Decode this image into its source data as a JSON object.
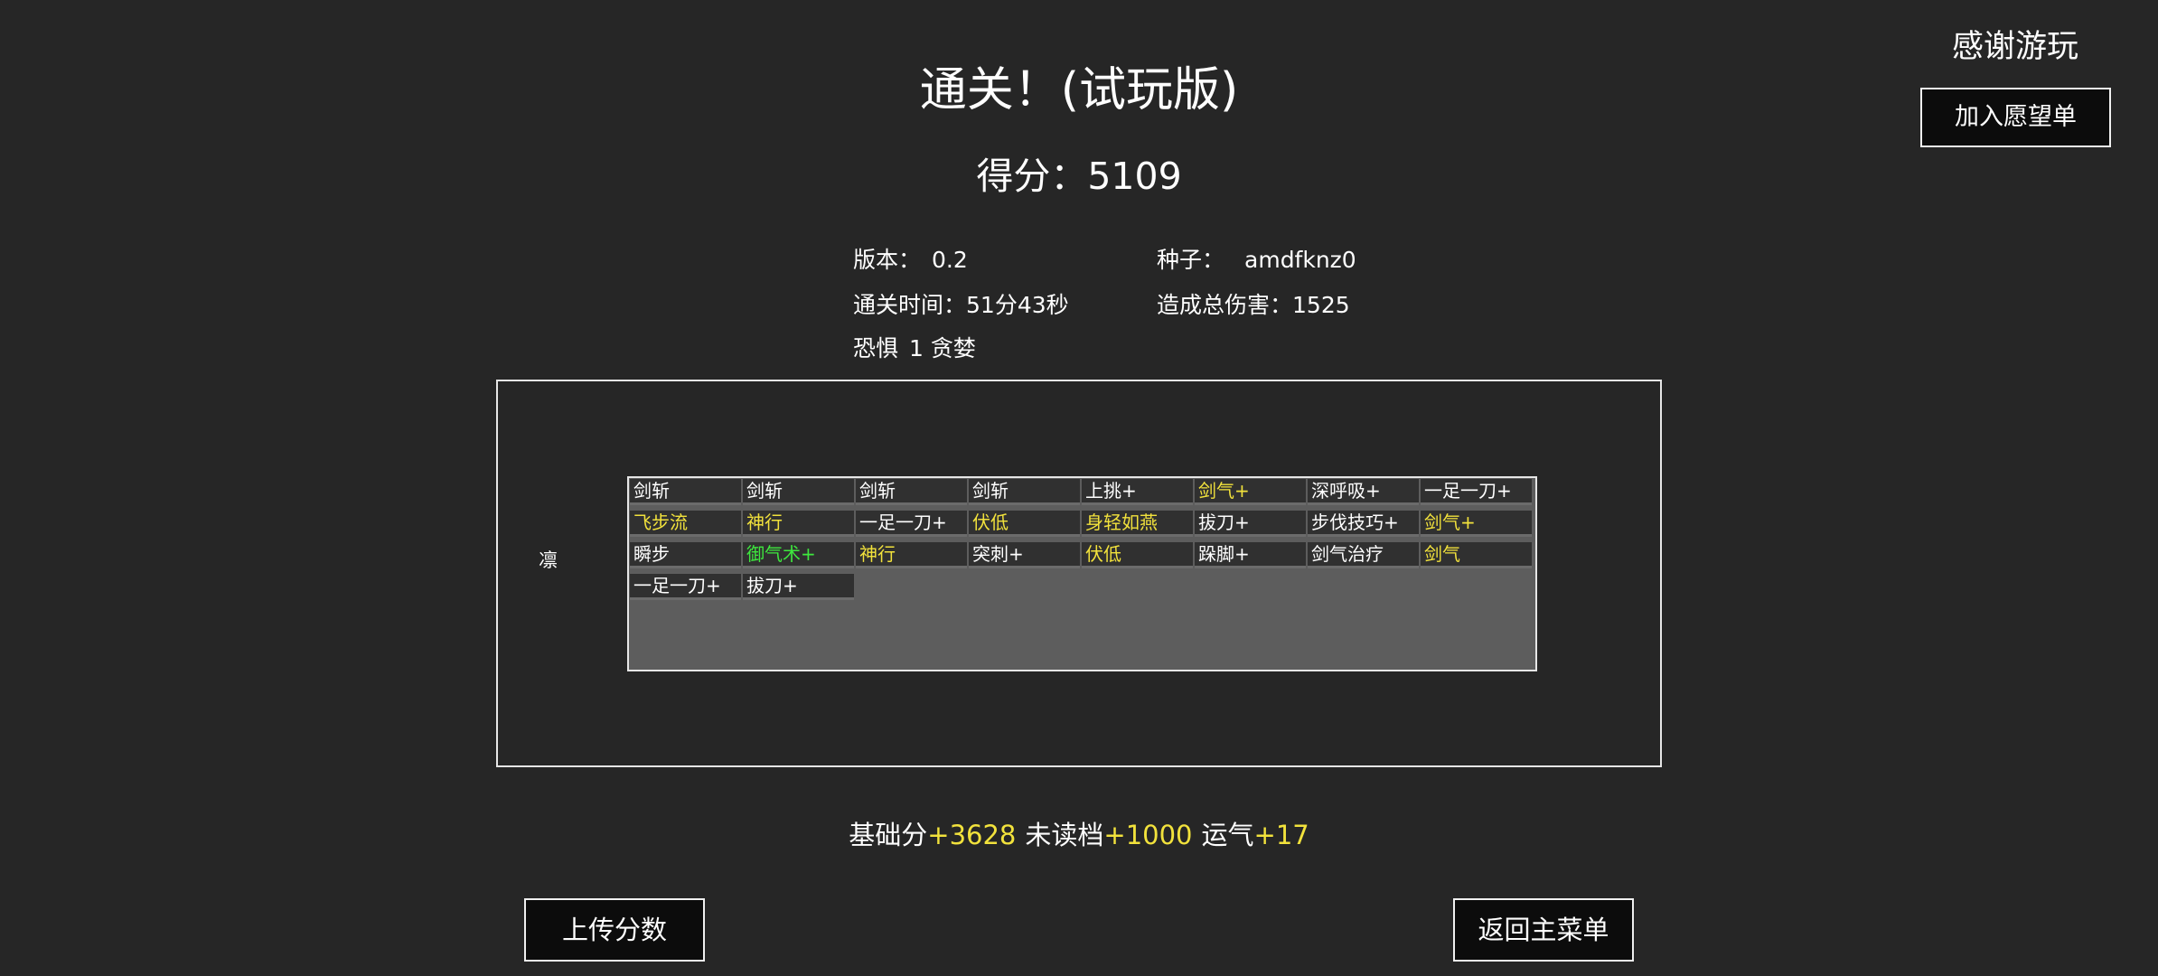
{
  "header": {
    "title": "通关！(试玩版)",
    "score_label": "得分：",
    "score_value": "5109"
  },
  "wishlist": {
    "thanks_text": "感谢游玩",
    "button_label": "加入愿望单"
  },
  "stats": {
    "version_label": "版本：",
    "version_value": "0.2",
    "seed_label": "种子：",
    "seed_value": "amdfknz0",
    "time_label": "通关时间：",
    "time_value": "51分43秒",
    "damage_label": "造成总伤害：",
    "damage_value": "1525",
    "fear_label": "恐惧",
    "fear_value": "1 贪婪"
  },
  "character": {
    "name": "凛"
  },
  "deck": {
    "rows": [
      [
        {
          "name": "剑斩",
          "color": "white"
        },
        {
          "name": "剑斩",
          "color": "white"
        },
        {
          "name": "剑斩",
          "color": "white"
        },
        {
          "name": "剑斩",
          "color": "white"
        },
        {
          "name": "上挑+",
          "color": "white"
        },
        {
          "name": "剑气+",
          "color": "yellow"
        },
        {
          "name": "深呼吸+",
          "color": "white"
        },
        {
          "name": "一足一刀+",
          "color": "white"
        }
      ],
      [
        {
          "name": "飞步流",
          "color": "yellow"
        },
        {
          "name": "神行",
          "color": "yellow"
        },
        {
          "name": "一足一刀+",
          "color": "white"
        },
        {
          "name": "伏低",
          "color": "yellow"
        },
        {
          "name": "身轻如燕",
          "color": "yellow"
        },
        {
          "name": "拔刀+",
          "color": "white"
        },
        {
          "name": "步伐技巧+",
          "color": "white"
        },
        {
          "name": "剑气+",
          "color": "yellow"
        }
      ],
      [
        {
          "name": "瞬步",
          "color": "white"
        },
        {
          "name": "御气术+",
          "color": "green"
        },
        {
          "name": "神行",
          "color": "yellow"
        },
        {
          "name": "突刺+",
          "color": "white"
        },
        {
          "name": "伏低",
          "color": "yellow"
        },
        {
          "name": "跺脚+",
          "color": "white"
        },
        {
          "name": "剑气治疗",
          "color": "white"
        },
        {
          "name": "剑气",
          "color": "yellow"
        }
      ],
      [
        {
          "name": "一足一刀+",
          "color": "white"
        },
        {
          "name": "拔刀+",
          "color": "white"
        }
      ]
    ]
  },
  "breakdown": {
    "base_label": "基础分",
    "base_value": "+3628",
    "noload_label": "未读档",
    "noload_value": "+1000",
    "luck_label": "运气",
    "luck_value": "+17"
  },
  "actions": {
    "upload_label": "上传分数",
    "menu_label": "返回主菜单"
  }
}
